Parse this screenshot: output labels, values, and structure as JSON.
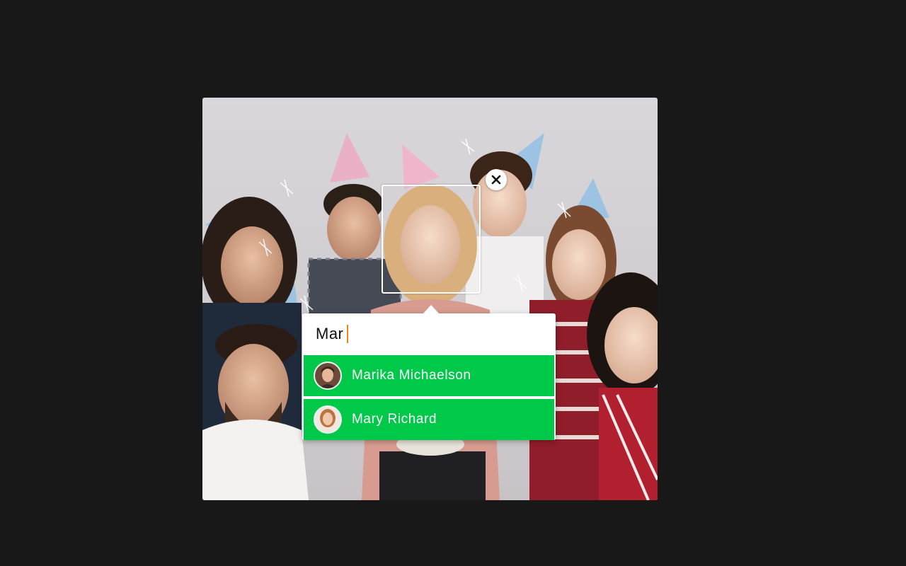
{
  "photo": {
    "description_icon": "party-photo"
  },
  "tag_popup": {
    "input_value": "Mar",
    "suggestions": [
      {
        "name": "Marika Michaelson",
        "avatar_icon": "avatar-marika"
      },
      {
        "name": "Mary Richard",
        "avatar_icon": "avatar-mary"
      }
    ]
  },
  "colors": {
    "suggestion_bg": "#00c94a",
    "cursor": "#e8861c",
    "page_bg": "#181818"
  },
  "icons": {
    "close": "close-icon"
  }
}
